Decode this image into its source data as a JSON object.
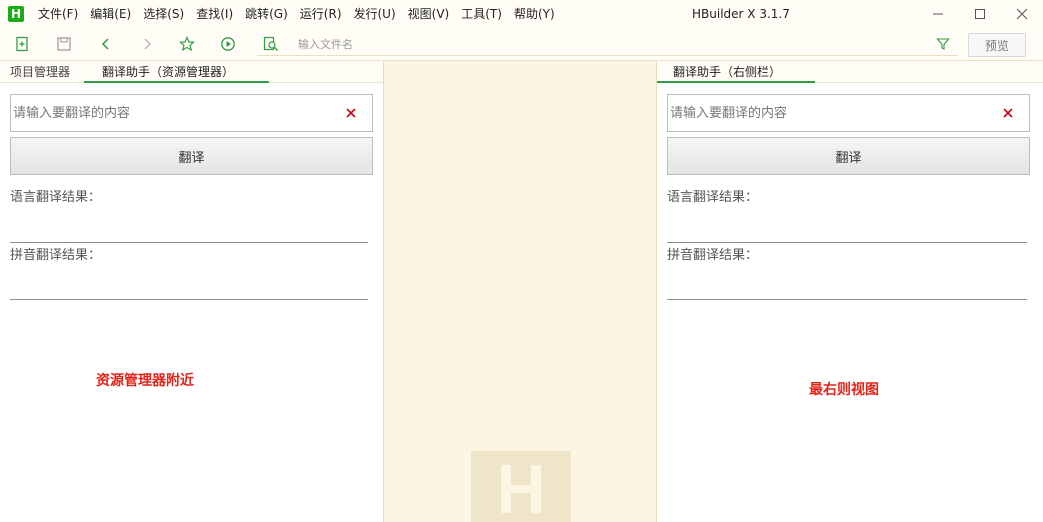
{
  "app": {
    "logo_letter": "H",
    "title": "HBuilder X 3.1.7"
  },
  "menu": [
    {
      "label": "文件(F)"
    },
    {
      "label": "编辑(E)"
    },
    {
      "label": "选择(S)"
    },
    {
      "label": "查找(I)"
    },
    {
      "label": "跳转(G)"
    },
    {
      "label": "运行(R)"
    },
    {
      "label": "发行(U)"
    },
    {
      "label": "视图(V)"
    },
    {
      "label": "工具(T)"
    },
    {
      "label": "帮助(Y)"
    }
  ],
  "window_controls": {
    "minimize": "—",
    "maximize": "☐",
    "close": "✕"
  },
  "toolbar": {
    "file_search_placeholder": "输入文件名",
    "preview_label": "预览",
    "icons": [
      "new-file-icon",
      "save-icon",
      "back-icon",
      "forward-icon",
      "star-icon",
      "run-icon",
      "file-search-icon",
      "filter-icon"
    ]
  },
  "left_panel": {
    "tabs": [
      {
        "label": "项目管理器",
        "active": false
      },
      {
        "label": "翻译助手（资源管理器）",
        "active": true
      }
    ],
    "input_placeholder": "请输入要翻译的内容",
    "clear_symbol": "✕",
    "translate_button": "翻译",
    "language_result_label": "语言翻译结果：",
    "pinyin_result_label": "拼音翻译结果：",
    "annotation": "资源管理器附近"
  },
  "right_panel": {
    "tabs": [
      {
        "label": "翻译助手（右侧栏）",
        "active": true
      }
    ],
    "input_placeholder": "请输入要翻译的内容",
    "clear_symbol": "✕",
    "translate_button": "翻译",
    "language_result_label": "语言翻译结果：",
    "pinyin_result_label": "拼音翻译结果：",
    "annotation": "最右则视图"
  },
  "colors": {
    "accent_green": "#2e9e48",
    "editor_background": "#fcf5e1",
    "annotation_red": "#e1251b",
    "clear_red": "#d0021b"
  }
}
